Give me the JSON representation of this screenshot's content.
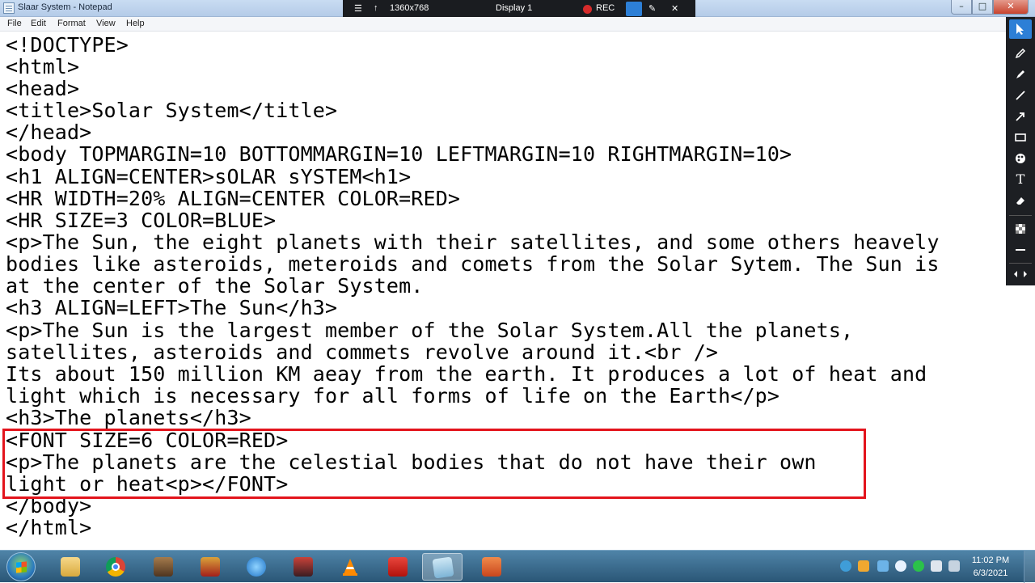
{
  "window": {
    "title": "Slaar System - Notepad",
    "min_glyph": "–",
    "max_glyph": "□",
    "close_glyph": "✕"
  },
  "recorder": {
    "resolution": "1360x768",
    "display": "Display 1",
    "rec_label": "REC",
    "menu_glyph": "☰",
    "pin_glyph": "↑",
    "close_glyph": "✕"
  },
  "menu": {
    "items": [
      "File",
      "Edit",
      "Format",
      "View",
      "Help"
    ]
  },
  "editor": {
    "lines": [
      "<!DOCTYPE>",
      "<html>",
      "<head>",
      "<title>Solar System</title>",
      "</head>",
      "<body TOPMARGIN=10 BOTTOMMARGIN=10 LEFTMARGIN=10 RIGHTMARGIN=10>",
      "<h1 ALIGN=CENTER>sOLAR sYSTEM<h1>",
      "<HR WIDTH=20% ALIGN=CENTER COLOR=RED>",
      "<HR SIZE=3 COLOR=BLUE>",
      "<p>The Sun, the eight planets with their satellites, and some others heavely",
      "bodies like asteroids, meteroids and comets from the Solar Sytem. The Sun is",
      "at the center of the Solar System.",
      "<h3 ALIGN=LEFT>The Sun</h3>",
      "<p>The Sun is the largest member of the Solar System.All the planets,",
      "satellites, asteroids and commets revolve around it.<br />",
      "Its about 150 million KM aeay from the earth. It produces a lot of heat and",
      "light which is necessary for all forms of life on the Earth</p>",
      "<h3>The planets</h3>",
      "<FONT SIZE=6 COLOR=RED>",
      "<p>The planets are the celestial bodies that do not have their own",
      "light or heat<p></FONT>",
      "</body>",
      "</html>"
    ],
    "highlight_color": "#e3141c"
  },
  "annotation_tools": [
    "cursor-icon",
    "pen-icon",
    "highlighter-icon",
    "line-icon",
    "arrow-icon",
    "rectangle-icon",
    "color-palette-icon",
    "text-icon",
    "eraser-icon",
    "checkerboard-icon",
    "divider-icon",
    "expand-icon"
  ],
  "tool_text": {
    "text_tool": "T"
  },
  "taskbar": {
    "apps": [
      "explorer-icon",
      "chrome-icon",
      "game-icon",
      "ironman-icon",
      "ie-icon",
      "tekken-icon",
      "vlc-icon",
      "acrobat-icon",
      "notepad-icon",
      "powerpoint-icon"
    ],
    "clock_time": "11:02 PM",
    "clock_date": "6/3/2021"
  }
}
